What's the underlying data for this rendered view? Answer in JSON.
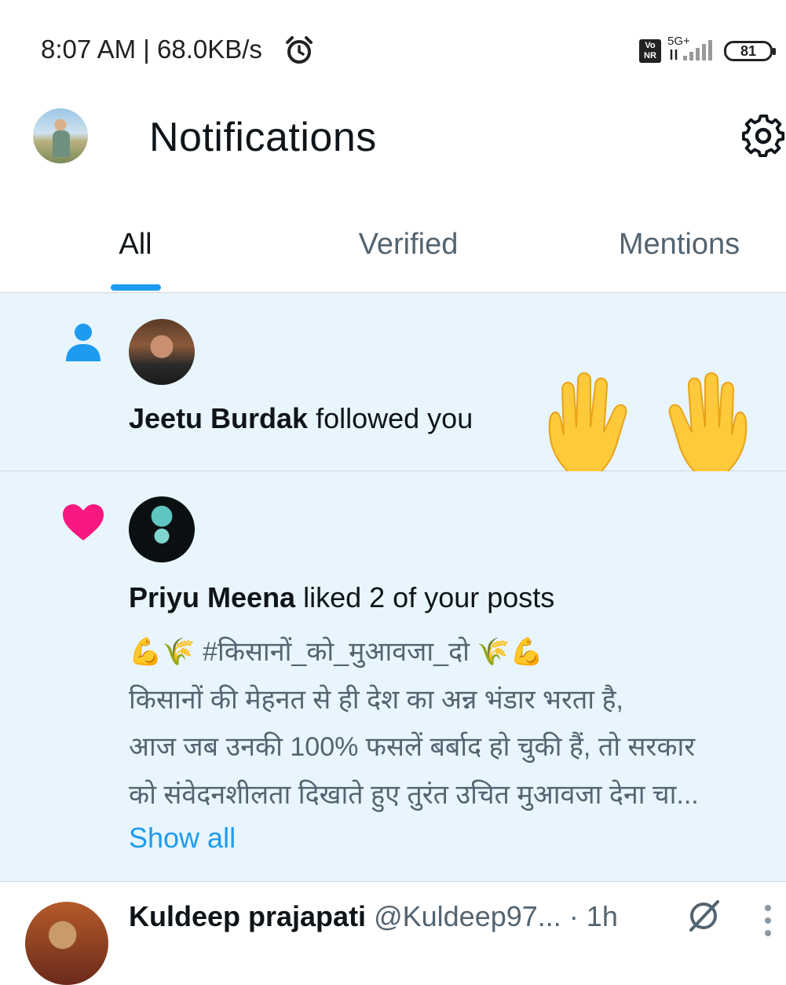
{
  "status_bar": {
    "time_speed": "8:07 AM | 68.0KB/s",
    "volte_label": "Vo NR",
    "network_type": "5G+",
    "battery_level": "81",
    "icons": [
      "alarm-icon",
      "signal-icon",
      "battery-icon"
    ]
  },
  "header": {
    "title": "Notifications",
    "icons": [
      "avatar",
      "gear-icon"
    ]
  },
  "tabs": [
    {
      "label": "All",
      "active": true
    },
    {
      "label": "Verified",
      "active": false
    },
    {
      "label": "Mentions",
      "active": false
    }
  ],
  "notifications": [
    {
      "type": "follow",
      "icon": "person-icon",
      "user": "Jeetu Burdak",
      "action": "followed you",
      "emoji": "🙌"
    },
    {
      "type": "like",
      "icon": "heart-icon",
      "user": "Priyu Meena",
      "action": "liked 2 of your posts",
      "post_lines": [
        "💪🌾 #किसानों_को_मुआवजा_दो 🌾💪",
        "किसानों की मेहनत से ही देश का अन्न भंडार भरता है,",
        "आज जब उनकी 100% फसलें बर्बाद हो चुकी हैं, तो सरकार",
        "को संवेदनशीलता दिखाते हुए तुरंत उचित मुआवजा देना चा..."
      ],
      "show_all_label": "Show all"
    }
  ],
  "tweet": {
    "name": "Kuldeep prajapati",
    "handle": "@Kuldeep97...",
    "time": "· 1h"
  },
  "colors": {
    "accent": "#1d9bf0",
    "like": "#f91880",
    "unread_bg": "#e8f5fd",
    "secondary_text": "#536471"
  }
}
